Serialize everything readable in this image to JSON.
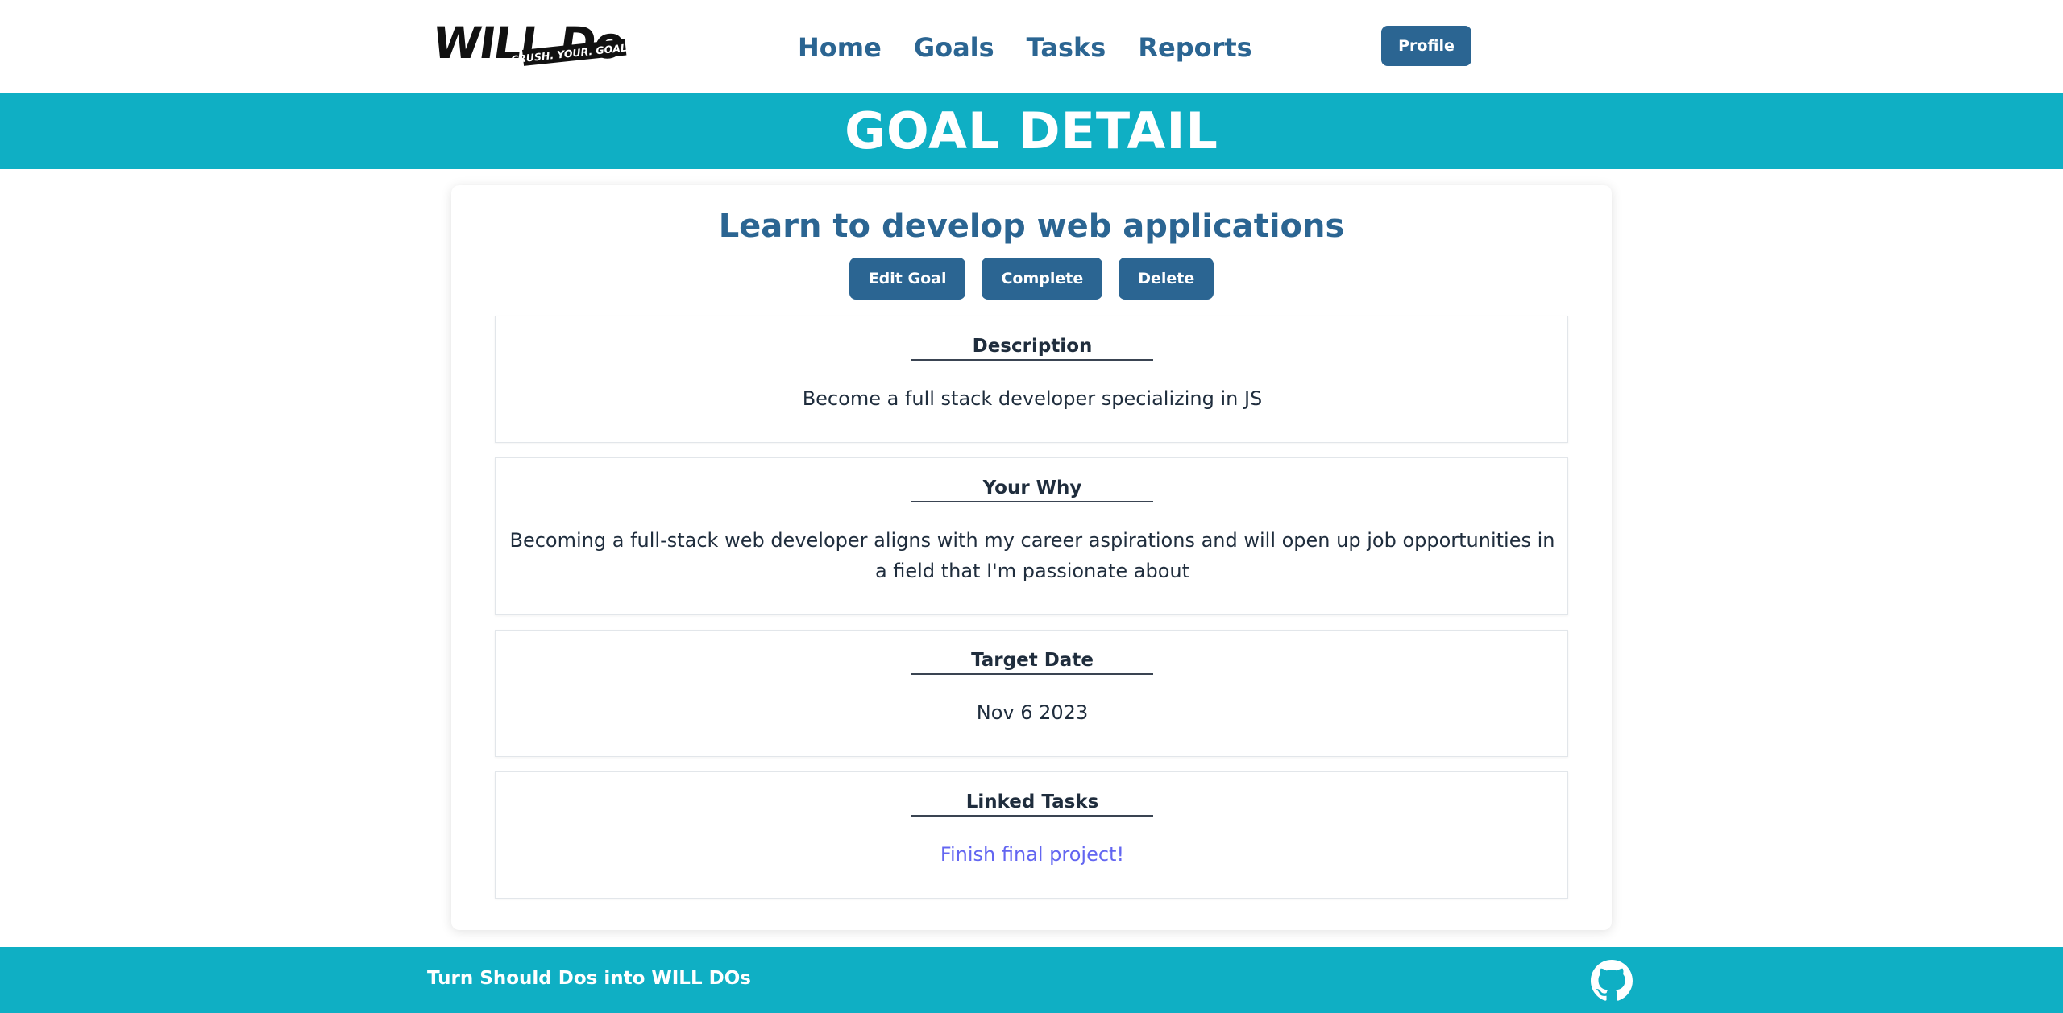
{
  "header": {
    "logo": {
      "main": "WILL Do",
      "tagline": "CRUSH. YOUR. GOALS."
    },
    "nav": [
      "Home",
      "Goals",
      "Tasks",
      "Reports"
    ],
    "profile_label": "Profile"
  },
  "banner": {
    "title": "GOAL DETAIL"
  },
  "goal": {
    "title": "Learn to develop web applications",
    "actions": {
      "edit": "Edit Goal",
      "complete": "Complete",
      "delete": "Delete"
    },
    "sections": {
      "description": {
        "heading": "Description",
        "text": "Become a full stack developer specializing in JS"
      },
      "why": {
        "heading": "Your Why",
        "text": "Becoming a full-stack web developer aligns with my career aspirations and will open up job opportunities in a field that I'm passionate about"
      },
      "target": {
        "heading": "Target Date",
        "text": "Nov 6 2023"
      },
      "linked": {
        "heading": "Linked Tasks",
        "tasks": [
          "Finish final project!"
        ]
      }
    }
  },
  "footer": {
    "text": "Turn Should Dos into WILL DOs",
    "icon": "github-icon"
  },
  "colors": {
    "brand": "#2b6592",
    "accent": "#0fafc4",
    "link": "#6366f1"
  }
}
